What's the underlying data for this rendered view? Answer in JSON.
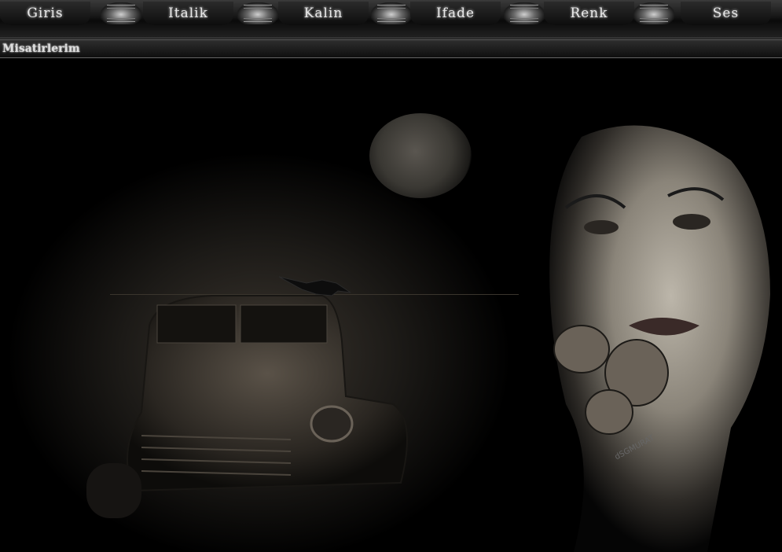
{
  "nav": {
    "items": [
      {
        "label": "Giris"
      },
      {
        "label": "Italik"
      },
      {
        "label": "Kalin"
      },
      {
        "label": "Ifade"
      },
      {
        "label": "Renk"
      },
      {
        "label": "Ses"
      }
    ]
  },
  "subbar": {
    "title": "Misatirlerim"
  },
  "artwork": {
    "signature": "dSGMURAT"
  },
  "colors": {
    "background": "#000000",
    "menu_text": "#e8e8e8"
  }
}
